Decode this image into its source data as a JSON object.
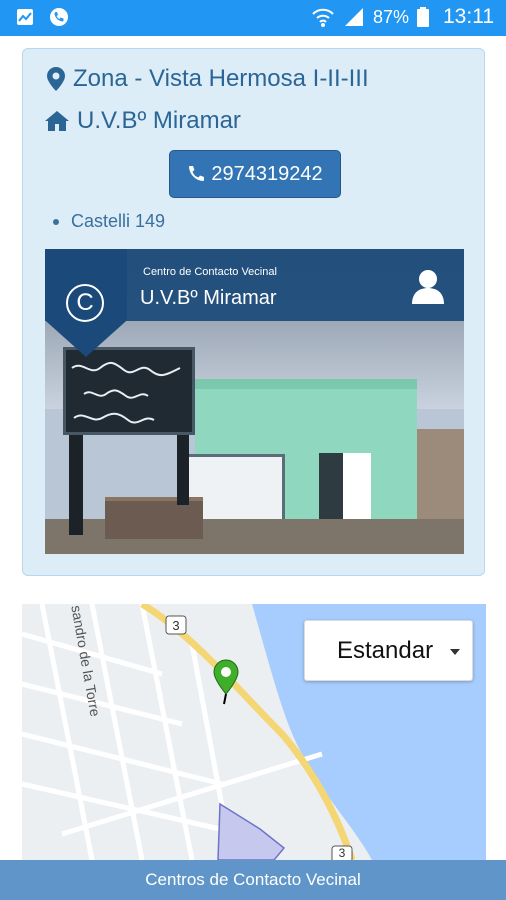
{
  "status_bar": {
    "battery": "87%",
    "time": "13:11"
  },
  "card": {
    "zone_label": "Zona - Vista Hermosa I-II-III",
    "uvb_label": "U.V.Bº Miramar",
    "phone": "2974319242",
    "address": "Castelli 149"
  },
  "photo": {
    "header_small": "Centro de Contacto Vecinal",
    "header_title": "U.V.Bº Miramar",
    "logo_letter": "C",
    "sign_text": "Unión Vecinal\nBarrio\nMiramar"
  },
  "map": {
    "map_type_selected": "Estandar",
    "street_label": "sandro de la Torre",
    "route_badge": "3"
  },
  "footer": {
    "label": "Centros de Contacto Vecinal"
  },
  "colors": {
    "status_bar": "#2196f3",
    "card_bg": "#dcedf8",
    "accent_text": "#2b6596",
    "phone_button": "#3274b4",
    "footer_bg": "#5f95c8"
  }
}
